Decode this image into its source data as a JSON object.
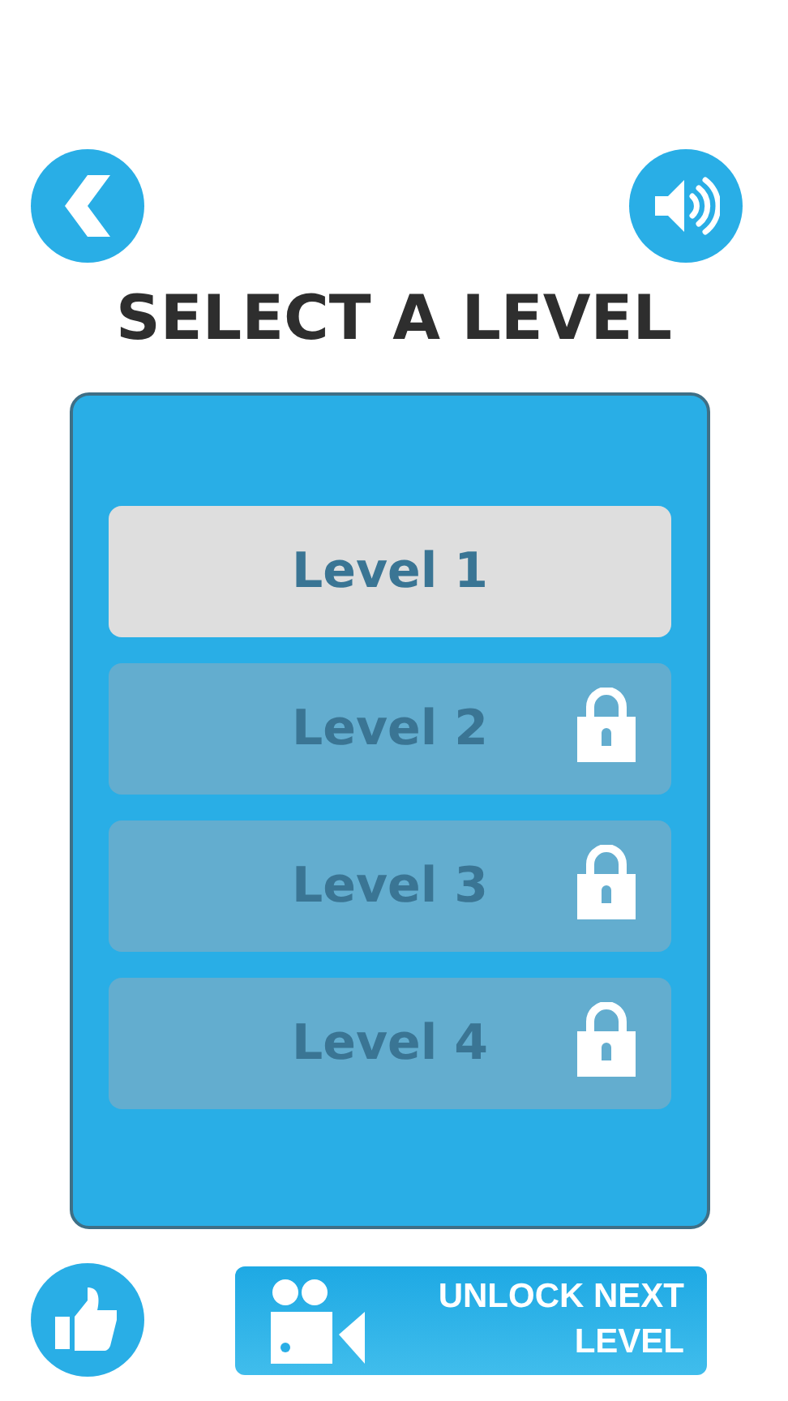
{
  "title": "SELECT A LEVEL",
  "levels": [
    {
      "label": "Level 1",
      "locked": false
    },
    {
      "label": "Level 2",
      "locked": true
    },
    {
      "label": "Level 3",
      "locked": true
    },
    {
      "label": "Level 4",
      "locked": true
    }
  ],
  "unlock_button": {
    "lines": [
      "UNLOCK NEXT",
      "LEVEL"
    ]
  }
}
